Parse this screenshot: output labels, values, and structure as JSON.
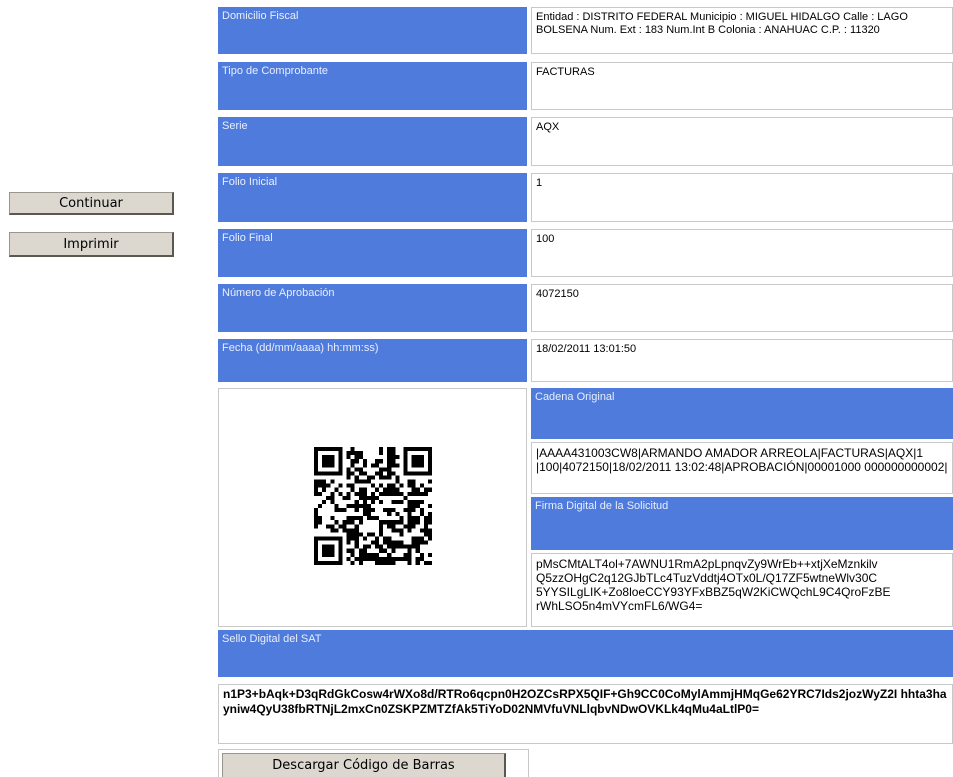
{
  "actions": {
    "continue_label": "Continuar",
    "print_label": "Imprimir",
    "download_label": "Descargar Código de Barras"
  },
  "rows": [
    {
      "label": "Domicilio Fiscal",
      "value": "Entidad : DISTRITO FEDERAL Municipio : MIGUEL HIDALGO Calle : LAGO BOLSENA Num. Ext : 183 Num.Int B Colonia : ANAHUAC C.P. : 11320"
    },
    {
      "label": "Tipo de Comprobante",
      "value": "FACTURAS"
    },
    {
      "label": "Serie",
      "value": "AQX"
    },
    {
      "label": "Folio Inicial",
      "value": "1"
    },
    {
      "label": "Folio Final",
      "value": "100"
    },
    {
      "label": "Número de Aprobación",
      "value": "4072150"
    },
    {
      "label": "Fecha (dd/mm/aaaa) hh:mm:ss)",
      "value": "18/02/2011 13:01:50"
    }
  ],
  "cadena": {
    "label": "Cadena Original",
    "value": "|AAAA431003CW8|ARMANDO AMADOR ARREOLA|FACTURAS|AQX|1 |100|4072150|18/02/2011 13:02:48|APROBACIÓN|00001000 000000000002|"
  },
  "firma": {
    "label": "Firma Digital de la Solicitud",
    "value": "pMsCMtALT4ol+7AWNU1RmA2pLpnqvZy9WrEb++xtjXeMznkilv Q5zzOHgC2q12GJbTLc4TuzVddtj4OTx0L/Q17ZF5wtneWlv30C 5YYSILgLIK+Zo8loeCCY93YFxBBZ5qW2KiCWQchL9C4QroFzBE rWhLSO5n4mVYcmFL6/WG4="
  },
  "sello": {
    "label": "Sello Digital del SAT",
    "value": "n1P3+bAqk+D3qRdGkCosw4rWXo8d/RTRo6qcpn0H2OZCsRPX5QIF+Gh9CC0CoMylAmmjHMqGe62YRC7Ids2jozWyZ2I hhta3hayniw4QyU38fbRTNjL2mxCn0ZSKPZMTZfAk5TiYoD02NMVfuVNLlqbvNDwOVKLk4qMu4aLtlP0="
  },
  "qr": {
    "icon": "qr-code"
  },
  "colors": {
    "label_bg": "#4f7bdc",
    "label_text": "#e8eefc"
  }
}
